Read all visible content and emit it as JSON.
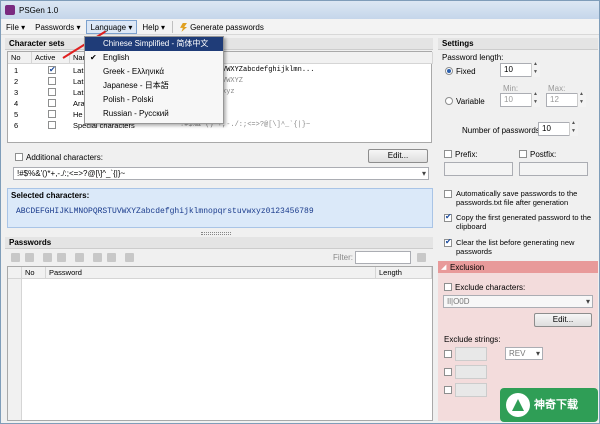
{
  "window": {
    "title": "PSGen 1.0"
  },
  "menubar": {
    "file": "File",
    "passwords": "Passwords",
    "language": "Language",
    "help": "Help",
    "generate": "Generate passwords"
  },
  "language_menu": {
    "items": [
      {
        "label": "Chinese Simplified - 简体中文",
        "checked": false,
        "highlighted": true
      },
      {
        "label": "English",
        "checked": true,
        "highlighted": false
      },
      {
        "label": "Greek - Ελληνικά",
        "checked": false,
        "highlighted": false
      },
      {
        "label": "Japanese - 日本語",
        "checked": false,
        "highlighted": false
      },
      {
        "label": "Polish - Polski",
        "checked": false,
        "highlighted": false
      },
      {
        "label": "Russian - Русский",
        "checked": false,
        "highlighted": false
      }
    ]
  },
  "charsets": {
    "header": "Character sets",
    "columns": [
      "No",
      "Active",
      "Nar"
    ],
    "rows": [
      {
        "no": "1",
        "active": true,
        "name": "Lat",
        "chars": "LMNOPQRSTUVWXYZabcdefghijklmn..."
      },
      {
        "no": "2",
        "active": false,
        "name": "Lat",
        "chars": "LMNOPQRSTUVWXYZ"
      },
      {
        "no": "3",
        "active": false,
        "name": "Lat",
        "chars": "nopqrstuvwxyz"
      },
      {
        "no": "4",
        "active": false,
        "name": "Ara",
        "chars": ""
      },
      {
        "no": "5",
        "active": false,
        "name": "He",
        "chars": "BCDEF"
      },
      {
        "no": "6",
        "active": false,
        "name": "Special characters",
        "chars": "!#$%&'()*+,-./:;<=>?@[\\]^_`{|}~"
      }
    ],
    "additional_label": "Additional characters:",
    "edit_button": "Edit...",
    "additional_value": "!#$%&'()*+,-./:;<=>?@[\\]^_`{|}~"
  },
  "selected": {
    "header": "Selected characters:",
    "value": "ABCDEFGHIJKLMNOPQRSTUVWXYZabcdefghijklmnopqrstuvwxyz0123456789"
  },
  "passwords": {
    "header": "Passwords",
    "filter_label": "Filter:",
    "columns": [
      "No",
      "Password",
      "Length"
    ]
  },
  "settings": {
    "header": "Settings",
    "length_label": "Password length:",
    "fixed_label": "Fixed",
    "fixed_value": "10",
    "variable_label": "Variable",
    "min_label": "Min:",
    "min_value": "10",
    "max_label": "Max:",
    "max_value": "12",
    "count_label": "Number of passwords:",
    "count_value": "10",
    "prefix_label": "Prefix:",
    "postfix_label": "Postfix:",
    "autosave_label": "Automatically save passwords to the passwords.txt file after generation",
    "copy_label": "Copy the first generated password to the clipboard",
    "clear_label": "Clear the list before generating new passwords"
  },
  "exclusion": {
    "header": "Exclusion",
    "exclude_chars_label": "Exclude characters:",
    "exclude_chars_value": "Il|O0D",
    "edit_button": "Edit...",
    "exclude_strings_label": "Exclude strings:",
    "combo_value": "REV"
  },
  "watermark": {
    "text": "神奇下载"
  },
  "colors": {
    "highlight": "#1f3c78",
    "exclusion_bg": "#f3dcdc",
    "selected_bg": "#dbe9f9",
    "arrow": "#e02020",
    "watermark": "#2f9e56"
  }
}
